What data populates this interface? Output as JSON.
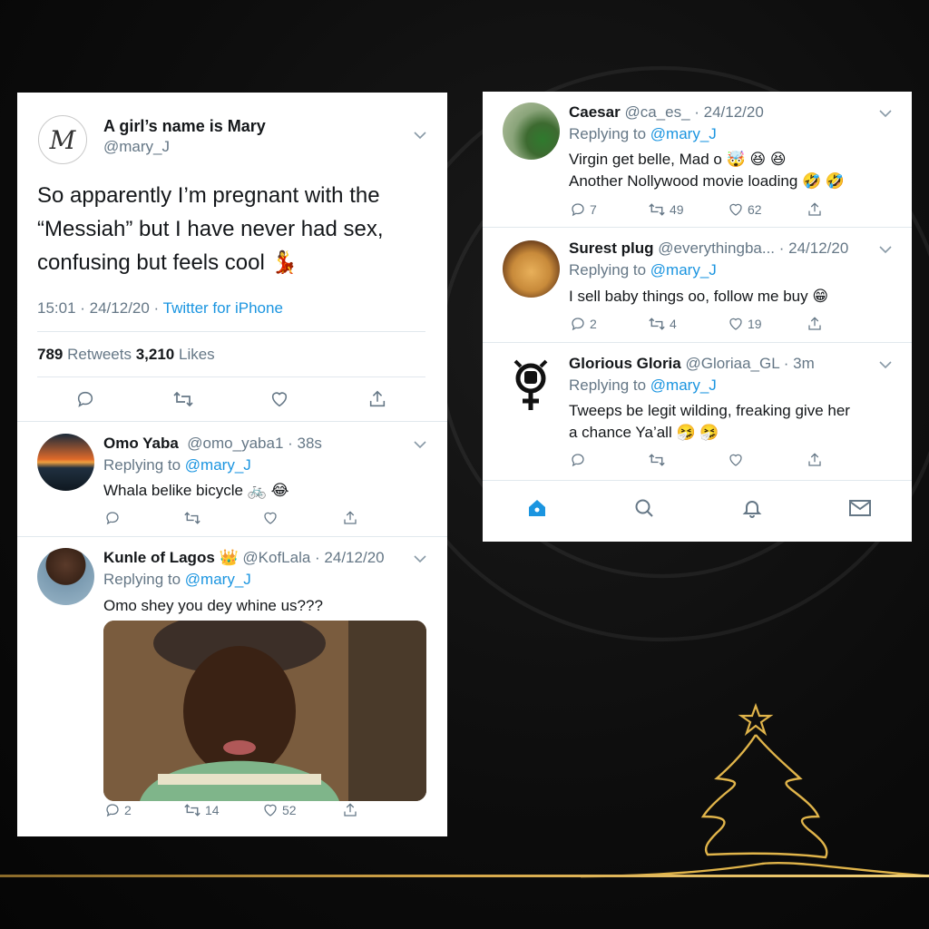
{
  "main_tweet": {
    "display_name": "A girl’s name is Mary",
    "handle": "@mary_J",
    "avatar_letter": "M",
    "text": "So apparently I’m pregnant with the “Messiah” but I have never had sex, confusing but feels cool 💃",
    "time": "15:01 · 24/12/20 · ",
    "source": "Twitter for iPhone",
    "retweets_count": "789",
    "retweets_label": "Retweets",
    "likes_count": "3,210",
    "likes_label": "Likes"
  },
  "left_replies": [
    {
      "name": "Omo Yaba",
      "handle": "@omo_yaba1 · 38s",
      "replying_label": "Replying to ",
      "replying_to": "@mary_J",
      "text": "Whala belike bicycle 🚲 😂",
      "reply_count": "",
      "retweet_count": "",
      "like_count": ""
    },
    {
      "name": "Kunle of Lagos 👑",
      "handle": "@KofLala · 24/12/20",
      "replying_label": "Replying to ",
      "replying_to": "@mary_J",
      "text": "Omo shey you dey whine us???",
      "reply_count": "2",
      "retweet_count": "14",
      "like_count": "52"
    }
  ],
  "right_replies": [
    {
      "name": "Caesar",
      "handle": "@ca_es_ · 24/12/20",
      "replying_label": "Replying to ",
      "replying_to": "@mary_J",
      "text_line1": "Virgin get belle, Mad o 🤯 😆 😆",
      "text_line2": "Another Nollywood movie loading 🤣 🤣",
      "reply_count": "7",
      "retweet_count": "49",
      "like_count": "62"
    },
    {
      "name": "Surest plug",
      "handle": "@everythingba... · 24/12/20",
      "replying_label": "Replying to ",
      "replying_to": "@mary_J",
      "text_line1": "I sell baby things oo, follow me buy 😁",
      "text_line2": "",
      "reply_count": "2",
      "retweet_count": "4",
      "like_count": "19"
    },
    {
      "name": "Glorious Gloria",
      "handle": "@Gloriaa_GL · 3m",
      "replying_label": "Replying to ",
      "replying_to": "@mary_J",
      "text_line1": "Tweeps be legit wilding, freaking give her",
      "text_line2": "a chance Ya’all 🤧 🤧",
      "reply_count": "",
      "retweet_count": "",
      "like_count": ""
    }
  ],
  "nav": {
    "items": [
      "home-icon",
      "search-icon",
      "bell-icon",
      "mail-icon"
    ],
    "active_color": "#1b95e0"
  },
  "colors": {
    "link": "#1b95e0",
    "muted": "#657786",
    "gold": "#d6a84a"
  }
}
